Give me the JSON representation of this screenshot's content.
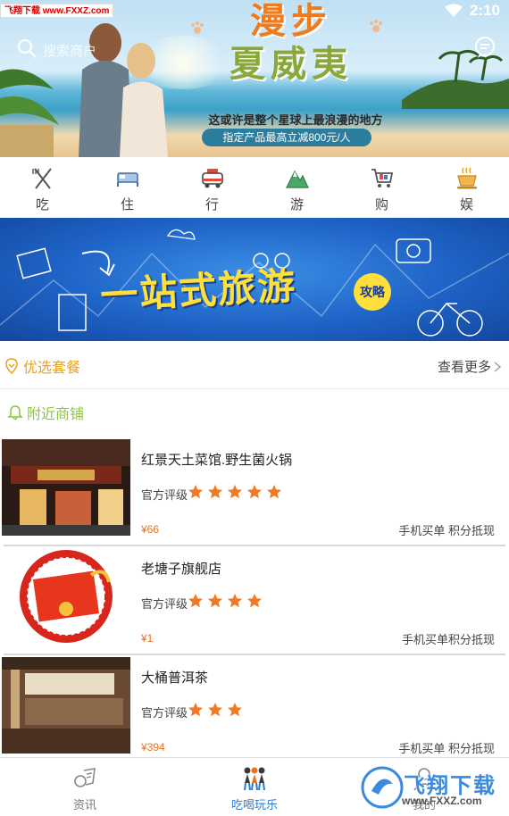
{
  "status": {
    "time": "2:10"
  },
  "watermark": {
    "top": "飞翔下载 www.FXXZ.com",
    "bottom_title": "飞翔下载",
    "bottom_url": "www.FXXZ.com"
  },
  "hero": {
    "search_hint": "搜索商户",
    "title_line1": "漫步",
    "title_line2": "夏威夷",
    "subtitle": "这或许是整个星球上最浪漫的地方",
    "tag": "指定产品最高立减800元/人"
  },
  "categories": [
    {
      "label": "吃",
      "icon": "fork-knife-icon"
    },
    {
      "label": "住",
      "icon": "bed-icon"
    },
    {
      "label": "行",
      "icon": "car-icon"
    },
    {
      "label": "游",
      "icon": "mountain-icon"
    },
    {
      "label": "购",
      "icon": "shopping-cart-icon"
    },
    {
      "label": "娱",
      "icon": "coffee-icon"
    }
  ],
  "travel_banner": {
    "title": "一站式旅游",
    "badge": "攻略"
  },
  "featured": {
    "title": "优选套餐",
    "more": "查看更多"
  },
  "nearby": {
    "title": "附近商铺"
  },
  "stores": [
    {
      "name": "红景天土菜馆.野生菌火锅",
      "rating_label": "官方评级",
      "stars": 5,
      "price": "¥66",
      "tags": "手机买单 积分抵现"
    },
    {
      "name": "老塘子旗舰店",
      "rating_label": "官方评级",
      "stars": 4,
      "price": "¥1",
      "tags": "手机买单积分抵现"
    },
    {
      "name": "大桶普洱茶",
      "rating_label": "官方评级",
      "stars": 3,
      "price": "¥394",
      "tags": "手机买单 积分抵现"
    }
  ],
  "bottom_nav": [
    {
      "label": "资讯",
      "active": false
    },
    {
      "label": "吃喝玩乐",
      "active": true
    },
    {
      "label": "我的",
      "active": false
    }
  ],
  "colors": {
    "accent": "#e8a21e",
    "green": "#8cc63f",
    "price": "#e8721e",
    "active_nav": "#2a7ad0",
    "star": "#f07a24"
  }
}
